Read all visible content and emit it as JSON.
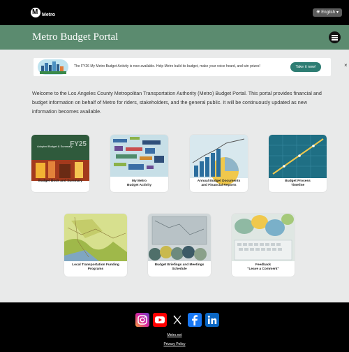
{
  "brand": {
    "logo_text": "Metro"
  },
  "language": {
    "selected": "English",
    "icon": "globe-icon"
  },
  "header": {
    "title": "Metro Budget Portal",
    "menu_icon": "hamburger-menu-icon"
  },
  "banner": {
    "message": "The FY26 My Metro Budget Activity is now available. Help Metro build its budget, make your voice heard, and win prizes!",
    "button_label": "Take it now!",
    "close_label": "×"
  },
  "welcome": {
    "text": "Welcome to the Los Angeles County Metropolitan Transportation Authority (Metro) Budget Portal. This portal provides financial and budget information on behalf of Metro for riders, stakeholders, and the general public. It will be continuously updated as new information becomes available."
  },
  "cards": [
    {
      "label": "Budget Book and Summary",
      "thumb_text": "Adopted Budget & Summary",
      "thumb_year": "FY25"
    },
    {
      "label": "My Metro\nBudget Activity"
    },
    {
      "label": "Annual Budget Documents\nand Financial Reports"
    },
    {
      "label": "Budget Process\nTimeline"
    },
    {
      "label": "Local Transportation Funding\nPrograms"
    },
    {
      "label": "Budget Briefings and Meetings\nSchedule"
    },
    {
      "label": "Feedback\n\"Leave a Comment\""
    }
  ],
  "footer": {
    "social": [
      {
        "icon": "instagram-icon",
        "color": "#d6249f"
      },
      {
        "icon": "youtube-icon",
        "color": "#ff0000"
      },
      {
        "icon": "x-icon",
        "color": "#000000"
      },
      {
        "icon": "facebook-icon",
        "color": "#1877f2"
      },
      {
        "icon": "linkedin-icon",
        "color": "#0a66c2"
      }
    ],
    "links": [
      "Metro.net",
      "Privacy Policy"
    ]
  },
  "colors": {
    "header_green": "#5b8b6f",
    "button_teal": "#2e7d73"
  }
}
